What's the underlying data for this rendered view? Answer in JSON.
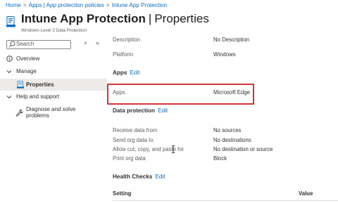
{
  "breadcrumb": {
    "items": [
      "Home",
      "Apps | App protection policies",
      "Intune App Protection"
    ],
    "separator": ">"
  },
  "header": {
    "title": "Intune App Protection",
    "divider": "|",
    "subtitle_section": "Properties",
    "more": "...",
    "description": "Windows-Level 2 Data Protection"
  },
  "search": {
    "placeholder": "Search",
    "clear": "×",
    "collapse": "«"
  },
  "nav": {
    "overview": "Overview",
    "manage": "Manage",
    "properties": "Properties",
    "help_support": "Help and support",
    "diagnose_line1": "Diagnose and solve",
    "diagnose_line2": "problems"
  },
  "properties": {
    "description_label": "Description",
    "description_value": "No Description",
    "platform_label": "Platform",
    "platform_value": "Windows"
  },
  "apps_section": {
    "title": "Apps",
    "edit": "Edit",
    "apps_label": "Apps",
    "apps_value": "Microsoft Edge"
  },
  "data_protection": {
    "title": "Data protection",
    "edit": "Edit",
    "rows": [
      {
        "label": "Receive data from",
        "value": "No sources"
      },
      {
        "label": "Send org data to",
        "value": "No destinations"
      },
      {
        "label": "Allow cut, copy, and paste for",
        "value": "No destination or source"
      },
      {
        "label": "Print org data",
        "value": "Block"
      }
    ]
  },
  "health_checks": {
    "title": "Health Checks",
    "edit": "Edit",
    "col_setting": "Setting",
    "col_value": "Value"
  },
  "colors": {
    "accent": "#0f6cbd",
    "highlight": "#d13438",
    "nav_active": "#edebe9"
  }
}
